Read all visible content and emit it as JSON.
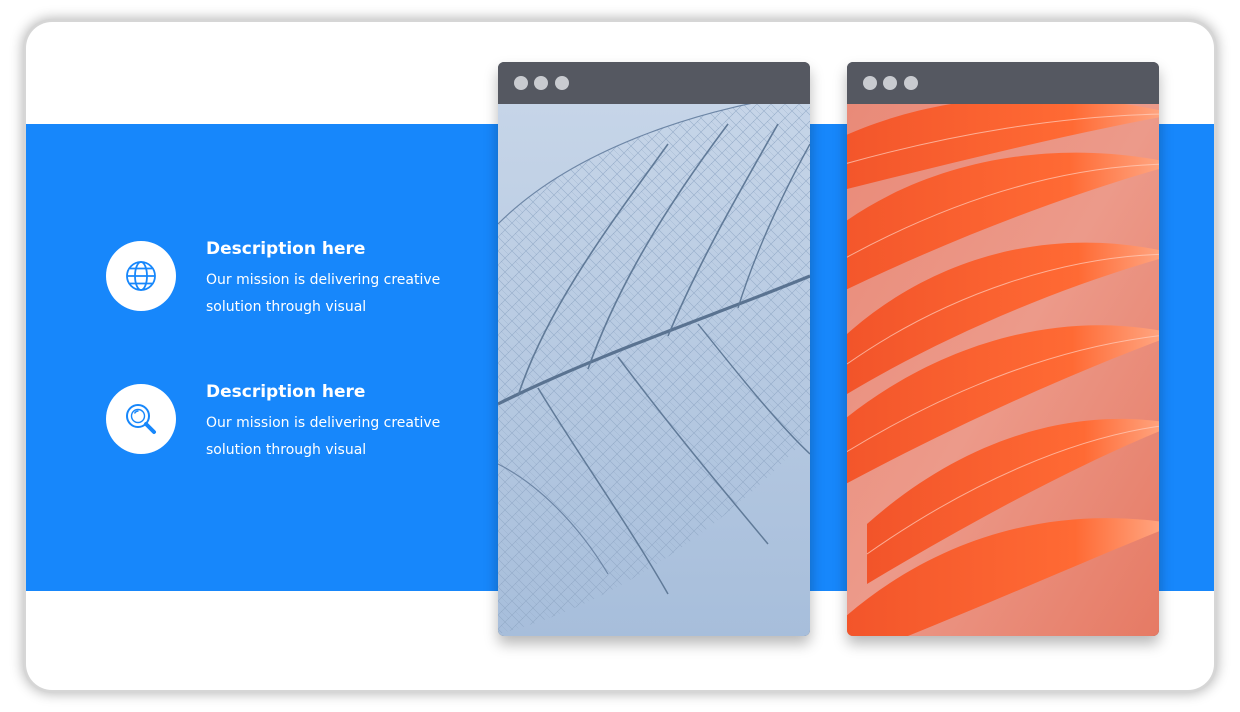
{
  "colors": {
    "band": "#1787fb",
    "window_bar": "#555861",
    "window_dots": "#c9cbd0",
    "text": "#ffffff",
    "icon": "#1787fb"
  },
  "features": [
    {
      "icon": "globe-icon",
      "title": "Description here",
      "text": "Our mission is delivering creative solution through visual"
    },
    {
      "icon": "search-icon",
      "title": "Description here",
      "text": "Our mission is delivering creative solution through visual"
    }
  ],
  "windows": [
    {
      "image": "leaf-skeleton-photo",
      "dots": 3
    },
    {
      "image": "flamingo-feathers-photo",
      "dots": 3
    }
  ]
}
